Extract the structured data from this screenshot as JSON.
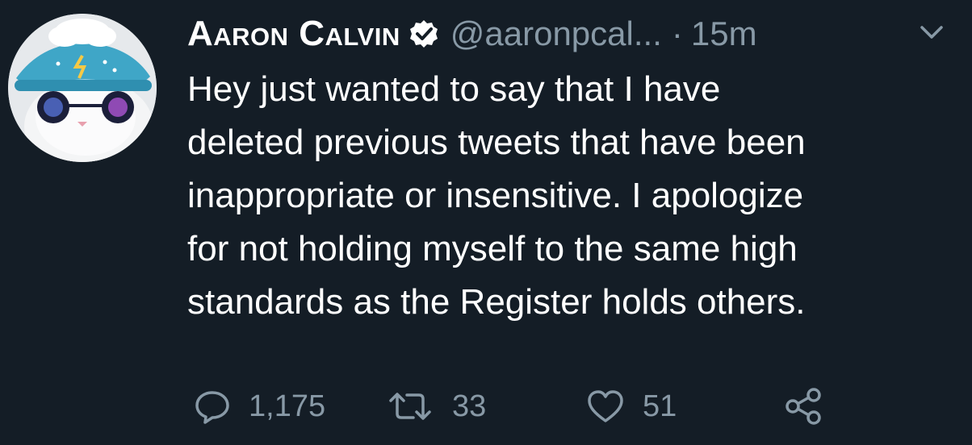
{
  "tweet": {
    "author": {
      "display_name": "Aaron Calvin",
      "handle": "@aaronpcal...",
      "verified": true,
      "avatar": "cat-with-rain-cloud-hat-and-sunglasses"
    },
    "separator": "·",
    "time": "15m",
    "menu_icon": "chevron-down-icon",
    "body_lines": [
      "Hey just wanted to say that I have",
      "deleted previous tweets that have been",
      "inappropriate or insensitive. I apologize",
      "for not holding myself to the same high",
      "standards as the Register holds others."
    ],
    "actions": {
      "reply": {
        "icon": "reply-icon",
        "count": "1,175"
      },
      "retweet": {
        "icon": "retweet-icon",
        "count": "33"
      },
      "like": {
        "icon": "heart-icon",
        "count": "51"
      },
      "share": {
        "icon": "share-icon"
      }
    }
  },
  "colors": {
    "background": "#141d26",
    "text": "#ffffff",
    "muted": "#8899a6"
  }
}
